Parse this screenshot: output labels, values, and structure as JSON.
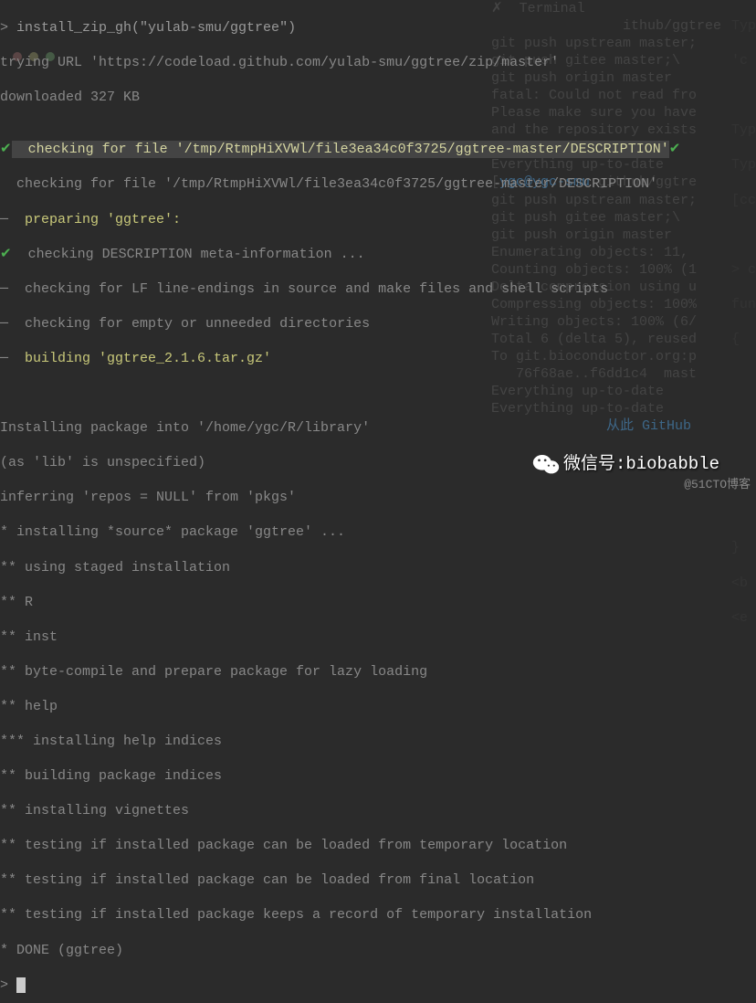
{
  "fg": {
    "l1_prompt": "> ",
    "l1_cmd": "install_zip_gh(\"yulab-smu/ggtree\")",
    "l2": "trying URL 'https://codeload.github.com/yulab-smu/ggtree/zip/master'",
    "l3": "downloaded 327 KB",
    "l4": "",
    "l5_check": "✔",
    "l5_text": "  checking for file '/tmp/RtmpHiXVWl/file3ea34c0f3725/ggtree-master/DESCRIPTION'",
    "l5_trail": "✔",
    "l6": "  checking for file '/tmp/RtmpHiXVWl/file3ea34c0f3725/ggtree-master/DESCRIPTION'",
    "l7_dash": "─",
    "l7_text": "  preparing 'ggtree':",
    "l8_check": "✔",
    "l8_text": "  checking DESCRIPTION meta-information ...",
    "l9_dash": "─",
    "l9_text": "  checking for LF line-endings in source and make files and shell scripts",
    "l10_dash": "─",
    "l10_text": "  checking for empty or unneeded directories",
    "l11_dash": "─",
    "l11_text": "  building 'ggtree_2.1.6.tar.gz'",
    "l12": "   ",
    "l13": "Installing package into '/home/ygc/R/library'",
    "l14": "(as 'lib' is unspecified)",
    "l15": "inferring 'repos = NULL' from 'pkgs'",
    "l16": "* installing *source* package 'ggtree' ...",
    "l17": "** using staged installation",
    "l18": "** R",
    "l19": "** inst",
    "l20": "** byte-compile and prepare package for lazy loading",
    "l21": "** help",
    "l22": "*** installing help indices",
    "l23": "** building package indices",
    "l24": "** installing vignettes",
    "l25": "** testing if installed package can be loaded from temporary location",
    "l26": "** testing if installed package can be loaded from final location",
    "l27": "** testing if installed package keeps a record of temporary installation",
    "l28": "* DONE (ggtree)",
    "l29_prompt": "> "
  },
  "bg_right": {
    "r0": "✗  Terminal",
    "r1": "                ithub/ggtree",
    "r2": "git push upstream master;",
    "r3": "git push gitee master;\\",
    "r4": "git push origin master",
    "r5": "fatal: Could not read fro",
    "r6": "",
    "r7": "Please make sure you have",
    "r8": "and the repository exists",
    "r9": "Everything up-to-date",
    "r10": "Everything up-to-date",
    "r11_pre": "[",
    "r11_link": "ygc@ygc-smu",
    "r11_post": ":github/ggtre",
    "r12": "git push upstream master;",
    "r13": "git push gitee master;\\",
    "r14": "git push origin master",
    "r15": "Enumerating objects: 11,",
    "r16": "Counting objects: 100% (1",
    "r17": "Delta compression using u",
    "r18": "Compressing objects: 100%",
    "r19": "Writing objects: 100% (6/",
    "r20": "Total 6 (delta 5), reused",
    "r21": "To git.bioconductor.org:p",
    "r22": "   76f68ae..f6dd1c4  mast",
    "r23": "Everything up-to-date",
    "r24": "Everything up-to-date",
    "r26_a": "从此 GitHub"
  },
  "top_right": {
    "t1": "Typ",
    "t2": "'c",
    "t3": "Typ",
    "t4": "Typ",
    "t5": "[cc",
    "t6": "> c",
    "t7": "fun",
    "t8": "{",
    "t9": "    ",
    "t10": "    ",
    "t11": "    ",
    "t12": "    ",
    "t13": "}",
    "t14": "<b",
    "t15": "<e"
  },
  "watermark1": "微信号:biobabble",
  "watermark2": "@51CTO博客"
}
